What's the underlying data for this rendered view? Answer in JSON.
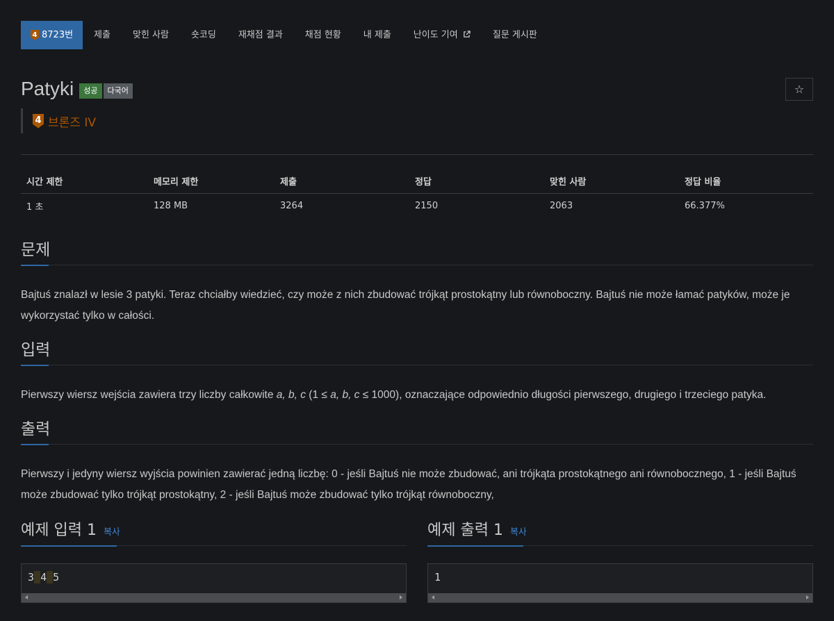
{
  "tabs": [
    {
      "label": "8723번",
      "tier_num": "4",
      "active": true
    },
    {
      "label": "제출"
    },
    {
      "label": "맞힌 사람"
    },
    {
      "label": "숏코딩"
    },
    {
      "label": "재채점 결과"
    },
    {
      "label": "채점 현황"
    },
    {
      "label": "내 제출"
    },
    {
      "label": "난이도 기여"
    },
    {
      "label": "질문 게시판"
    }
  ],
  "problem": {
    "title": "Patyki",
    "labels": {
      "success": "성공",
      "multilang": "다국어"
    },
    "tier": {
      "num": "4",
      "text": "브론즈 IV",
      "color": "#ad5600"
    },
    "star_icon": "☆"
  },
  "stats": {
    "headers": [
      "시간 제한",
      "메모리 제한",
      "제출",
      "정답",
      "맞힌 사람",
      "정답 비율"
    ],
    "values": [
      "1 초",
      "128 MB",
      "3264",
      "2150",
      "2063",
      "66.377%"
    ]
  },
  "sections": {
    "problem": {
      "title": "문제",
      "body": "Bajtuś znalazł w lesie 3 patyki. Teraz chciałby wiedzieć, czy może z nich zbudować trójkąt prostokątny lub równoboczny. Bajtuś nie może łamać patyków, może je wykorzystać tylko w całości."
    },
    "input": {
      "title": "입력",
      "body_pre": "Pierwszy wiersz wejścia zawiera trzy liczby całkowite ",
      "vars": "a, b, c",
      "body_mid": " (1 ≤ ",
      "vars2": "a, b, c",
      "body_post": " ≤ 1000), oznaczające odpowiednio długości pierwszego, drugiego i trzeciego patyka."
    },
    "output": {
      "title": "출력",
      "body": "Pierwszy i jedyny wiersz wyjścia powinien zawierać jedną liczbę: 0 - jeśli Bajtuś nie może zbudować, ani trójkąta prostokątnego ani równobocznego, 1 - jeśli Bajtuś może zbudować tylko trójkąt prostokątny, 2 - jeśli Bajtuś może zbudować tylko trójkąt równoboczny,"
    }
  },
  "samples": {
    "input": {
      "title": "예제 입력 1",
      "copy": "복사",
      "tokens": [
        "3",
        "4",
        "5"
      ]
    },
    "output": {
      "title": "예제 출력 1",
      "copy": "복사",
      "value": "1"
    }
  },
  "colors": {
    "accent": "#2f67a3",
    "link": "#3c87d4",
    "bronze": "#ad5600",
    "success": "#3c763d"
  }
}
